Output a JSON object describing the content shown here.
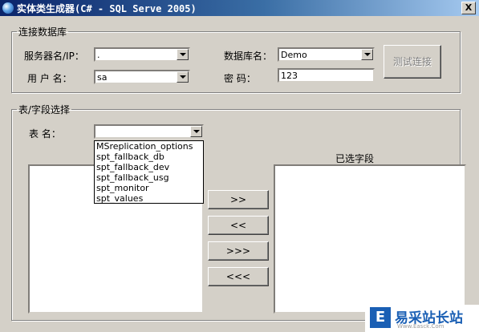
{
  "window": {
    "title": "实体类生成器(C# - SQL Serve 2005)",
    "close_label": "X"
  },
  "connection": {
    "legend": "连接数据库",
    "server_label": "服务器名/IP：",
    "server_value": ".",
    "db_label": "数据库名：",
    "db_value": "Demo",
    "user_label": "用 户 名：",
    "user_value": "sa",
    "password_label": "密  码：",
    "password_value": "123",
    "test_button": "测试连接"
  },
  "table_section": {
    "legend": "表/字段选择",
    "table_label": "表  名：",
    "table_value": "",
    "dropdown_options": [
      "MSreplication_options",
      "spt_fallback_db",
      "spt_fallback_dev",
      "spt_fallback_usg",
      "spt_monitor",
      "spt_values"
    ],
    "selected_fields_label": "已选字段",
    "buttons": {
      "add": ">>",
      "remove": "<<",
      "add_all": ">>>",
      "remove_all": "<<<"
    }
  },
  "watermark": {
    "logo_letter": "E",
    "text": "易采站长站",
    "sub": "Www.Easck.Com"
  }
}
